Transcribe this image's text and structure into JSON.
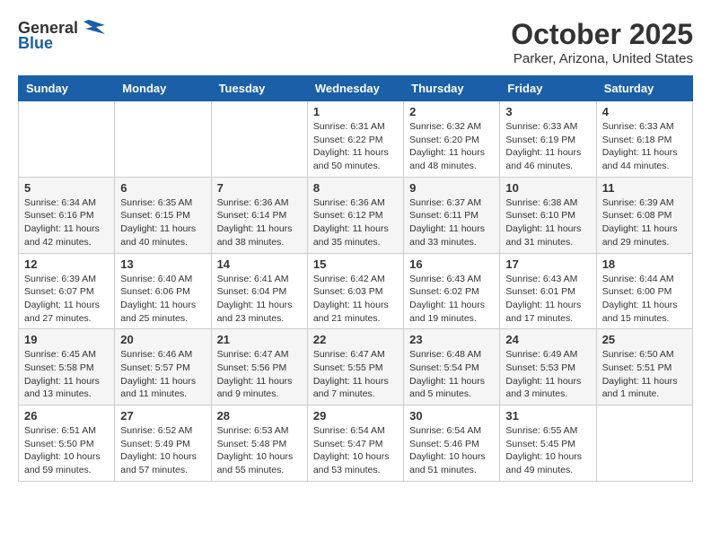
{
  "header": {
    "logo_general": "General",
    "logo_blue": "Blue",
    "month_title": "October 2025",
    "location": "Parker, Arizona, United States"
  },
  "days_of_week": [
    "Sunday",
    "Monday",
    "Tuesday",
    "Wednesday",
    "Thursday",
    "Friday",
    "Saturday"
  ],
  "weeks": [
    [
      {
        "day": "",
        "info": ""
      },
      {
        "day": "",
        "info": ""
      },
      {
        "day": "",
        "info": ""
      },
      {
        "day": "1",
        "info": "Sunrise: 6:31 AM\nSunset: 6:22 PM\nDaylight: 11 hours\nand 50 minutes."
      },
      {
        "day": "2",
        "info": "Sunrise: 6:32 AM\nSunset: 6:20 PM\nDaylight: 11 hours\nand 48 minutes."
      },
      {
        "day": "3",
        "info": "Sunrise: 6:33 AM\nSunset: 6:19 PM\nDaylight: 11 hours\nand 46 minutes."
      },
      {
        "day": "4",
        "info": "Sunrise: 6:33 AM\nSunset: 6:18 PM\nDaylight: 11 hours\nand 44 minutes."
      }
    ],
    [
      {
        "day": "5",
        "info": "Sunrise: 6:34 AM\nSunset: 6:16 PM\nDaylight: 11 hours\nand 42 minutes."
      },
      {
        "day": "6",
        "info": "Sunrise: 6:35 AM\nSunset: 6:15 PM\nDaylight: 11 hours\nand 40 minutes."
      },
      {
        "day": "7",
        "info": "Sunrise: 6:36 AM\nSunset: 6:14 PM\nDaylight: 11 hours\nand 38 minutes."
      },
      {
        "day": "8",
        "info": "Sunrise: 6:36 AM\nSunset: 6:12 PM\nDaylight: 11 hours\nand 35 minutes."
      },
      {
        "day": "9",
        "info": "Sunrise: 6:37 AM\nSunset: 6:11 PM\nDaylight: 11 hours\nand 33 minutes."
      },
      {
        "day": "10",
        "info": "Sunrise: 6:38 AM\nSunset: 6:10 PM\nDaylight: 11 hours\nand 31 minutes."
      },
      {
        "day": "11",
        "info": "Sunrise: 6:39 AM\nSunset: 6:08 PM\nDaylight: 11 hours\nand 29 minutes."
      }
    ],
    [
      {
        "day": "12",
        "info": "Sunrise: 6:39 AM\nSunset: 6:07 PM\nDaylight: 11 hours\nand 27 minutes."
      },
      {
        "day": "13",
        "info": "Sunrise: 6:40 AM\nSunset: 6:06 PM\nDaylight: 11 hours\nand 25 minutes."
      },
      {
        "day": "14",
        "info": "Sunrise: 6:41 AM\nSunset: 6:04 PM\nDaylight: 11 hours\nand 23 minutes."
      },
      {
        "day": "15",
        "info": "Sunrise: 6:42 AM\nSunset: 6:03 PM\nDaylight: 11 hours\nand 21 minutes."
      },
      {
        "day": "16",
        "info": "Sunrise: 6:43 AM\nSunset: 6:02 PM\nDaylight: 11 hours\nand 19 minutes."
      },
      {
        "day": "17",
        "info": "Sunrise: 6:43 AM\nSunset: 6:01 PM\nDaylight: 11 hours\nand 17 minutes."
      },
      {
        "day": "18",
        "info": "Sunrise: 6:44 AM\nSunset: 6:00 PM\nDaylight: 11 hours\nand 15 minutes."
      }
    ],
    [
      {
        "day": "19",
        "info": "Sunrise: 6:45 AM\nSunset: 5:58 PM\nDaylight: 11 hours\nand 13 minutes."
      },
      {
        "day": "20",
        "info": "Sunrise: 6:46 AM\nSunset: 5:57 PM\nDaylight: 11 hours\nand 11 minutes."
      },
      {
        "day": "21",
        "info": "Sunrise: 6:47 AM\nSunset: 5:56 PM\nDaylight: 11 hours\nand 9 minutes."
      },
      {
        "day": "22",
        "info": "Sunrise: 6:47 AM\nSunset: 5:55 PM\nDaylight: 11 hours\nand 7 minutes."
      },
      {
        "day": "23",
        "info": "Sunrise: 6:48 AM\nSunset: 5:54 PM\nDaylight: 11 hours\nand 5 minutes."
      },
      {
        "day": "24",
        "info": "Sunrise: 6:49 AM\nSunset: 5:53 PM\nDaylight: 11 hours\nand 3 minutes."
      },
      {
        "day": "25",
        "info": "Sunrise: 6:50 AM\nSunset: 5:51 PM\nDaylight: 11 hours\nand 1 minute."
      }
    ],
    [
      {
        "day": "26",
        "info": "Sunrise: 6:51 AM\nSunset: 5:50 PM\nDaylight: 10 hours\nand 59 minutes."
      },
      {
        "day": "27",
        "info": "Sunrise: 6:52 AM\nSunset: 5:49 PM\nDaylight: 10 hours\nand 57 minutes."
      },
      {
        "day": "28",
        "info": "Sunrise: 6:53 AM\nSunset: 5:48 PM\nDaylight: 10 hours\nand 55 minutes."
      },
      {
        "day": "29",
        "info": "Sunrise: 6:54 AM\nSunset: 5:47 PM\nDaylight: 10 hours\nand 53 minutes."
      },
      {
        "day": "30",
        "info": "Sunrise: 6:54 AM\nSunset: 5:46 PM\nDaylight: 10 hours\nand 51 minutes."
      },
      {
        "day": "31",
        "info": "Sunrise: 6:55 AM\nSunset: 5:45 PM\nDaylight: 10 hours\nand 49 minutes."
      },
      {
        "day": "",
        "info": ""
      }
    ]
  ]
}
